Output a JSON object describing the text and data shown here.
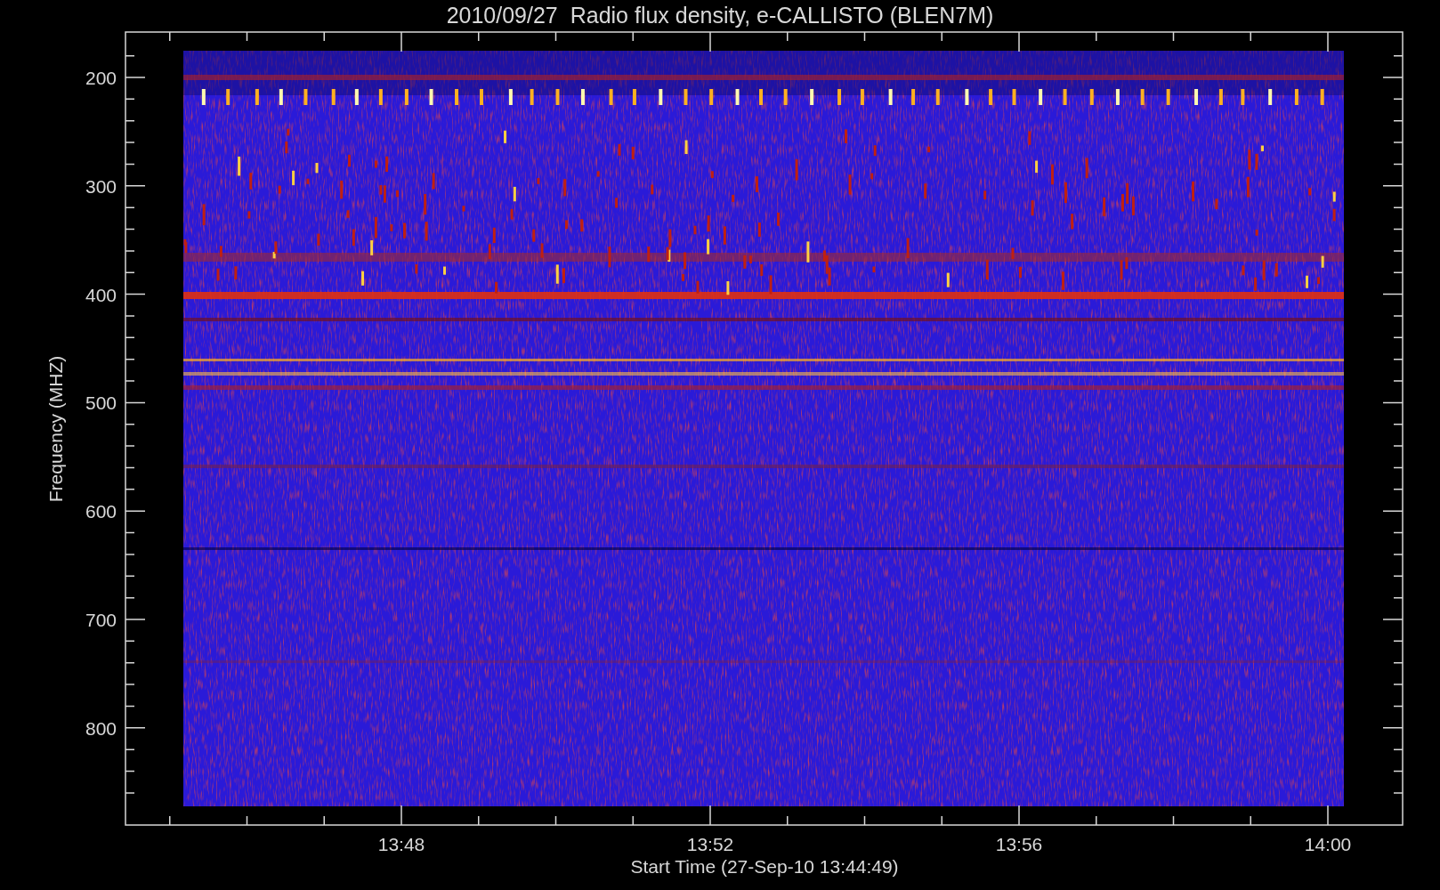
{
  "title": "2010/09/27  Radio flux density, e-CALLISTO (BLEN7M)",
  "y_axis": {
    "label": "Frequency (MHZ)",
    "ticks": [
      "200",
      "300",
      "400",
      "500",
      "600",
      "700",
      "800"
    ]
  },
  "x_axis": {
    "label": "Start Time (27-Sep-10 13:44:49)",
    "ticks": [
      "13:48",
      "13:52",
      "13:56",
      "14:00"
    ]
  }
}
